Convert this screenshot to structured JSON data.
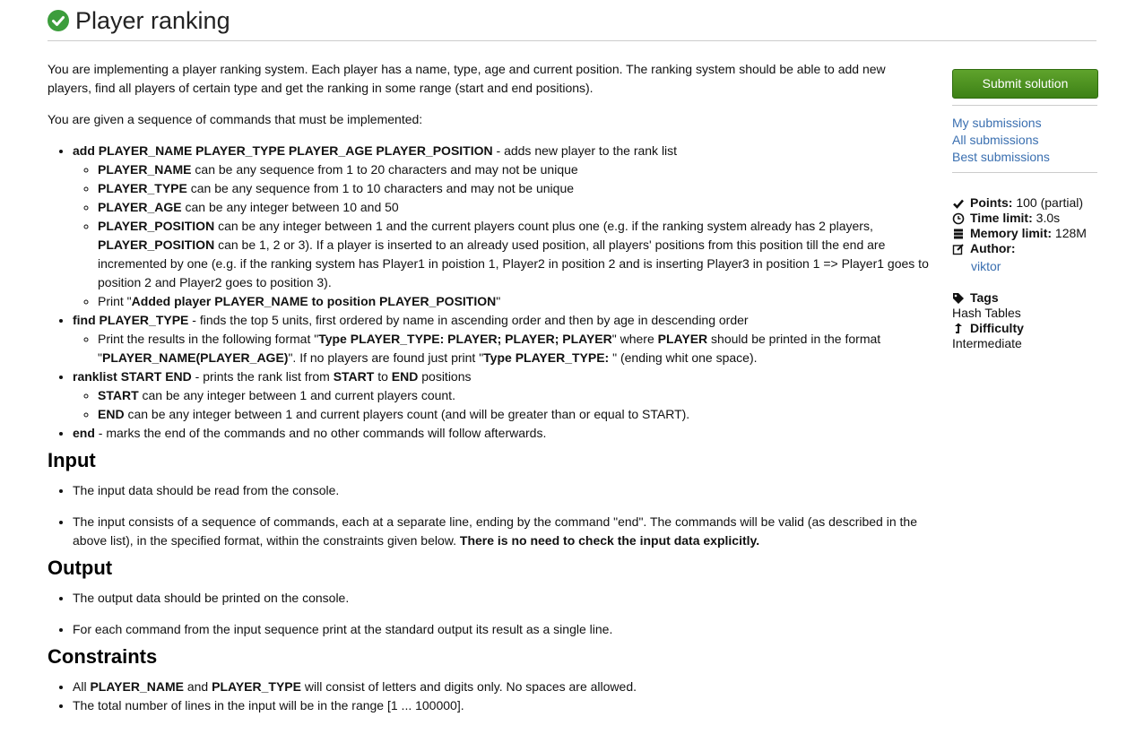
{
  "page": {
    "title": "Player ranking"
  },
  "statement": {
    "intro_1": "You are implementing a player ranking system. Each player has a name, type, age and current position. The ranking system should be able to add new players, find all players of certain type and get the ranking in some range (start and end positions).",
    "intro_2": "You are given a sequence of commands that must be implemented:",
    "cmd_add": "add PLAYER_NAME PLAYER_TYPE PLAYER_AGE PLAYER_POSITION",
    "cmd_add_desc": " - adds new player to the rank list",
    "pn_b": "PLAYER_NAME",
    "pn_desc": " can be any sequence from 1 to 20 characters and may not be unique",
    "pt_b": "PLAYER_TYPE",
    "pt_desc": " can be any sequence from 1 to 10 characters and may not be unique",
    "pa_b": "PLAYER_AGE",
    "pa_desc": " can be any integer between 10 and 50",
    "pp_b": "PLAYER_POSITION",
    "pp_desc1": " can be any integer between 1 and the current players count plus one (e.g. if the ranking system already has 2 players, ",
    "pp_b2": "PLAYER_POSITION",
    "pp_desc2": " can be 1, 2 or 3). If a player is inserted to an already used position, all players' positions from this position till the end are incremented by one (e.g. if the ranking system has Player1 in poistion 1, Player2 in position 2 and is inserting Player3 in position 1 => Player1 goes to position 2 and Player2 goes to position 3).",
    "print_pre": "Print \"",
    "print_b": "Added player PLAYER_NAME to position PLAYER_POSITION",
    "print_post": "\"",
    "cmd_find": "find PLAYER_TYPE",
    "cmd_find_desc": " - finds the top 5 units, first ordered by name in ascending order and then by age in descending order",
    "find_1": "Print the results in the following format \"",
    "find_b1": "Type PLAYER_TYPE: PLAYER; PLAYER; PLAYER",
    "find_2": "\" where ",
    "find_b2": "PLAYER",
    "find_3": " should be printed in the format \"",
    "find_b3": "PLAYER_NAME(PLAYER_AGE)",
    "find_4": "\". If no players are found just print \"",
    "find_b4": "Type PLAYER_TYPE: ",
    "find_5": "\" (ending whit one space).",
    "cmd_rank": "ranklist START END",
    "rank_desc1": " - prints the rank list from ",
    "rank_b1": "START",
    "rank_desc2": " to ",
    "rank_b2": "END",
    "rank_desc3": " positions",
    "start_b": "START",
    "start_desc": " can be any integer between 1 and current players count.",
    "end_b": "END",
    "end_desc": " can be any integer between 1 and current players count (and will be greater than or equal to START).",
    "cmd_end": "end",
    "cmd_end_desc": " - marks the end of the commands and no other commands will follow afterwards."
  },
  "input": {
    "heading": "Input",
    "item1": "The input data should be read from the console.",
    "item2": "The input consists of a sequence of commands, each at a separate line, ending by the command \"end\". The commands will be valid (as described in the above list), in the specified format, within the constraints given below. ",
    "item2_b": "There is no need to check the input data explicitly."
  },
  "output": {
    "heading": "Output",
    "item1": "The output data should be printed on the console.",
    "item2": "For each command from the input sequence print at the standard output its result as a single line."
  },
  "constraints": {
    "heading": "Constraints",
    "c1_pre": "All ",
    "c1_b1": "PLAYER_NAME",
    "c1_mid": " and ",
    "c1_b2": "PLAYER_TYPE",
    "c1_post": " will consist of letters and digits only. No spaces are allowed.",
    "c2": "The total number of lines in the input will be in the range [1 ... 100000]."
  },
  "sidebar": {
    "submit_label": "Submit solution",
    "my_submissions": "My submissions",
    "all_submissions": "All submissions",
    "best_submissions": "Best submissions",
    "points_label": "Points:",
    "points_value": " 100 (partial)",
    "time_label": "Time limit:",
    "time_value": " 3.0s",
    "memory_label": "Memory limit:",
    "memory_value": " 128M",
    "author_label": "Author:",
    "author_value": "viktor",
    "tags_label": "Tags",
    "tags_value": "Hash Tables",
    "difficulty_label": "Difficulty",
    "difficulty_value": "Intermediate"
  },
  "colors": {
    "accent_green": "#3d8116",
    "link_blue": "#3a6fb0",
    "check_green": "#3c9d3c"
  }
}
